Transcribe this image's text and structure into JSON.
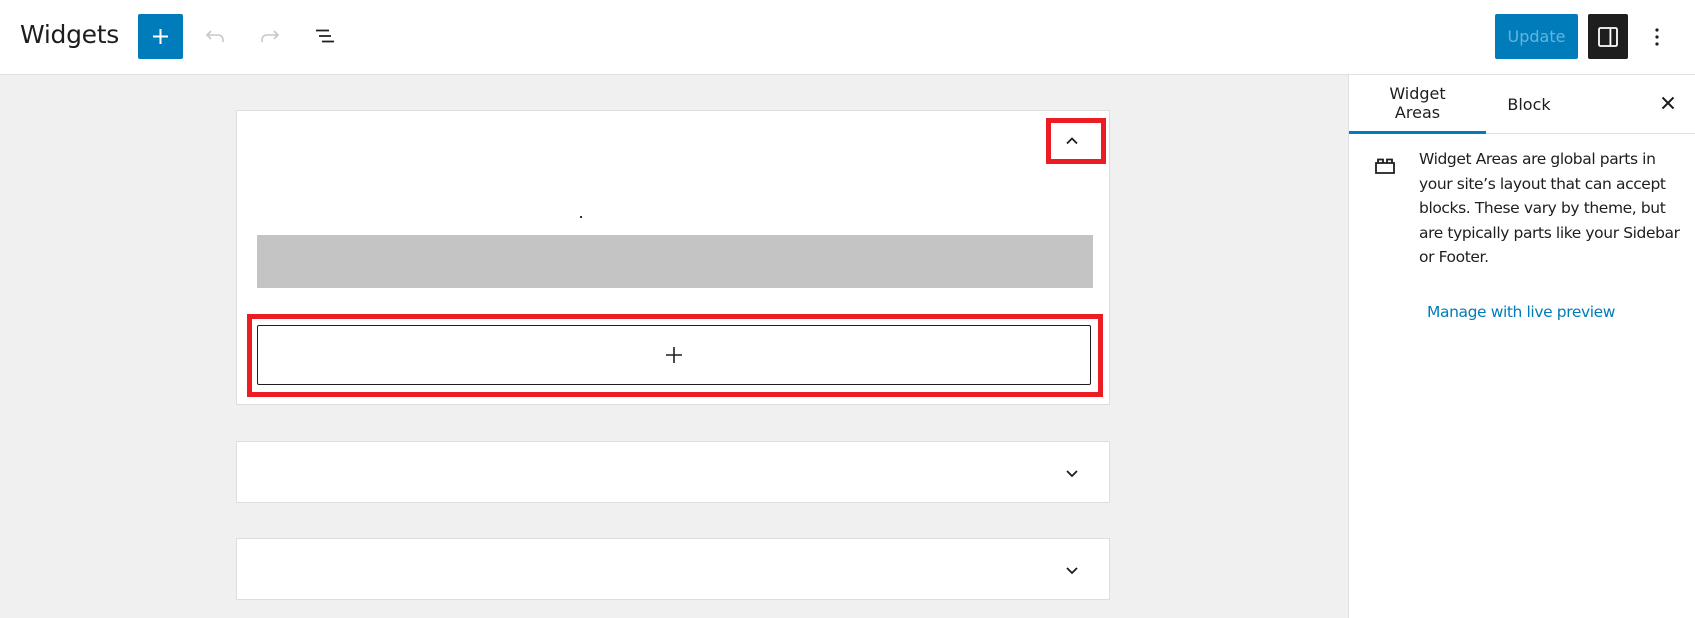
{
  "header": {
    "title": "Widgets",
    "add_block_icon": "plus-icon",
    "undo_icon": "undo-icon",
    "redo_icon": "redo-icon",
    "list_view_icon": "list-view-icon",
    "update_label": "Update",
    "sidebar_toggle_icon": "sidebar-toggle-icon",
    "options_icon": "more-vertical-icon"
  },
  "canvas": {
    "widget_areas": [
      {
        "expanded": true,
        "toggle_icon": "chevron-up-icon",
        "appender_icon": "plus-icon"
      },
      {
        "expanded": false,
        "toggle_icon": "chevron-down-icon"
      },
      {
        "expanded": false,
        "toggle_icon": "chevron-down-icon"
      }
    ]
  },
  "sidebar": {
    "tabs": [
      {
        "label": "Widget Areas",
        "active": true
      },
      {
        "label": "Block",
        "active": false
      }
    ],
    "close_icon": "close-icon",
    "info_icon": "block-default-icon",
    "description": "Widget Areas are global parts in your site’s layout that can accept blocks. These vary by theme, but are typically parts like your Sidebar or Footer.",
    "link_label": "Manage with live preview"
  },
  "colors": {
    "accent": "#007cba",
    "highlight": "#ec1c24",
    "canvas_bg": "#f0f0f0",
    "placeholder": "#c4c4c4"
  }
}
